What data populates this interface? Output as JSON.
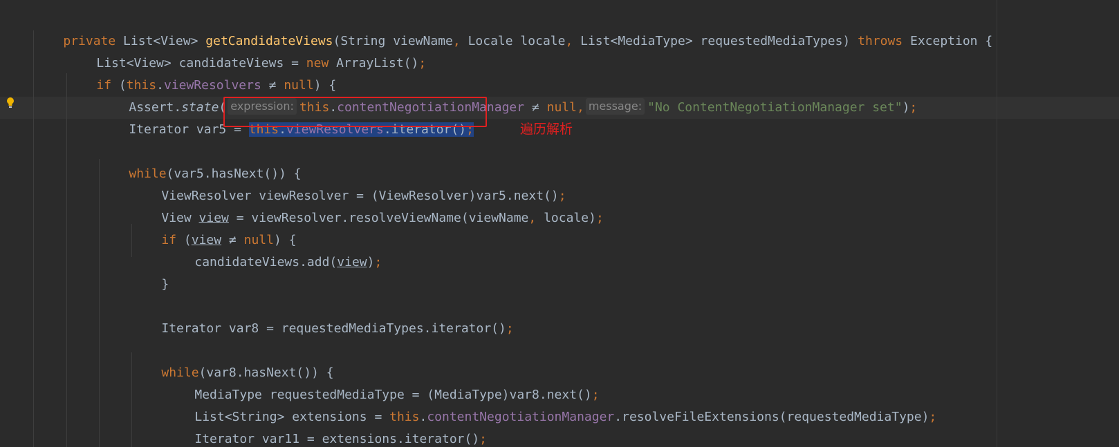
{
  "annotation": {
    "note": "遍历解析",
    "color": "#e02020"
  },
  "colors": {
    "background": "#2b2b2b",
    "keyword": "#cc7832",
    "method": "#ffc66d",
    "field": "#9876aa",
    "string": "#6a8759",
    "text": "#a9b7c6",
    "selection": "#214283"
  },
  "code": {
    "l1": {
      "private": "private",
      "t1": " List<View> ",
      "method": "getCandidateViews",
      "t2": "(String viewName",
      "c1": ",",
      "t3": " Locale locale",
      "c2": ",",
      "t4": " List<MediaType> requestedMediaTypes) ",
      "throws": "throws",
      "t5": " Exception {"
    },
    "l2": {
      "t1": "List<View> candidateViews = ",
      "new": "new",
      "t2": " ArrayList()",
      "semi": ";"
    },
    "l3": {
      "if": "if",
      "t1": " (",
      "this": "this",
      "dot": ".",
      "field": "viewResolvers",
      "t2": " ≠ ",
      "null": "null",
      "t3": ") {"
    },
    "l4": {
      "t1": "Assert.",
      "state": "state",
      "paren": "(",
      "hint1": "expression:",
      "this": "this",
      "dot": ".",
      "field": "contentNegotiationManager",
      "t2": " ≠ ",
      "null": "null",
      "comma": ",",
      "hint2": "message:",
      "str": "\"No ContentNegotiationManager set\"",
      "t3": ")",
      "semi": ";"
    },
    "l5": {
      "t1": "Iterator var5 = ",
      "this": "this",
      "dot": ".",
      "field": "viewResolvers",
      "t2": ".iterator()",
      "semi": ";"
    },
    "l7": {
      "while": "while",
      "t1": "(var5.hasNext()) {"
    },
    "l8": {
      "t1": "ViewResolver viewResolver = (ViewResolver)var5.next()",
      "semi": ";"
    },
    "l9": {
      "t1": "View ",
      "view": "view",
      "t2": " = viewResolver.resolveViewName(viewName",
      "comma": ",",
      "t3": " locale)",
      "semi": ";"
    },
    "l10": {
      "if": "if",
      "t1": " (",
      "view": "view",
      "t2": " ≠ ",
      "null": "null",
      "t3": ") {"
    },
    "l11": {
      "t1": "candidateViews.add(",
      "view": "view",
      "t2": ")",
      "semi": ";"
    },
    "l12": {
      "t1": "}"
    },
    "l14": {
      "t1": "Iterator var8 = requestedMediaTypes.iterator()",
      "semi": ";"
    },
    "l16": {
      "while": "while",
      "t1": "(var8.hasNext()) {"
    },
    "l17": {
      "t1": "MediaType requestedMediaType = (MediaType)var8.next()",
      "semi": ";"
    },
    "l18": {
      "t1": "List<String> extensions = ",
      "this": "this",
      "dot": ".",
      "field": "contentNegotiationManager",
      "t2": ".resolveFileExtensions(requestedMediaType)",
      "semi": ";"
    },
    "l19": {
      "t1": "Iterator var11 = extensions.iterator()",
      "semi": ";"
    }
  }
}
